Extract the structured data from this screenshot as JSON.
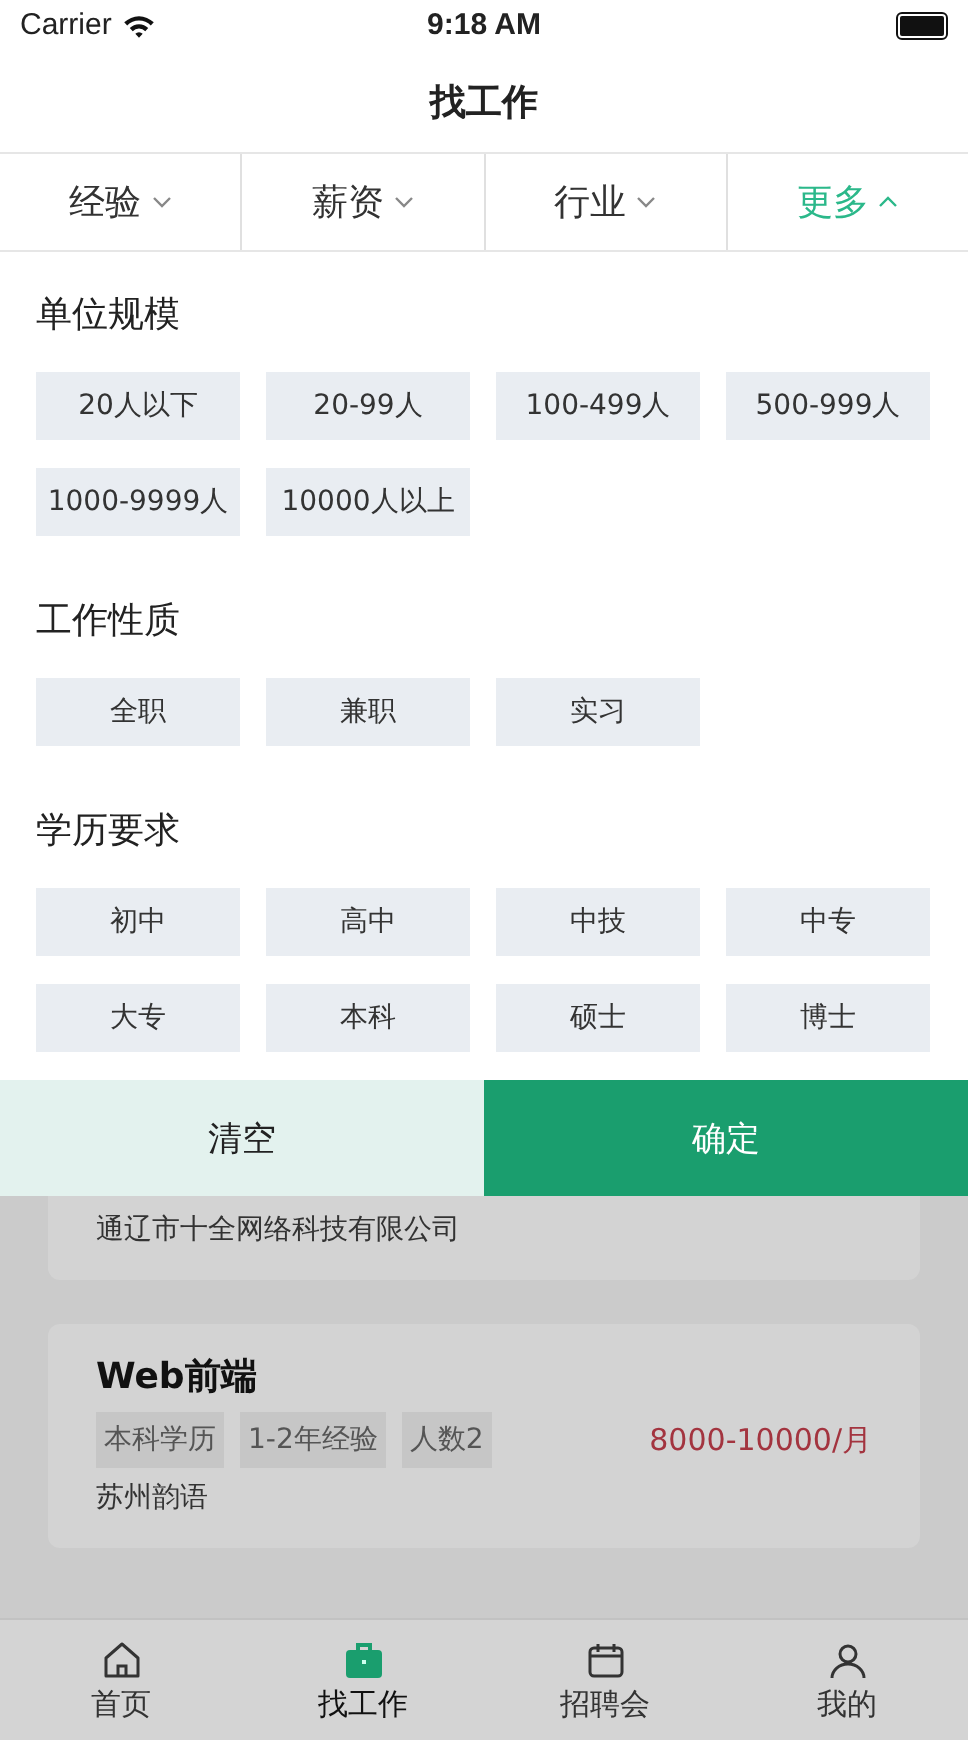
{
  "status_bar": {
    "carrier": "Carrier",
    "time": "9:18 AM"
  },
  "nav": {
    "title": "找工作"
  },
  "filter_tabs": [
    {
      "label": "经验",
      "selected": false
    },
    {
      "label": "薪资",
      "selected": false
    },
    {
      "label": "行业",
      "selected": false
    },
    {
      "label": "更多",
      "selected": true
    }
  ],
  "sections": [
    {
      "title": "单位规模",
      "options": [
        {
          "label": "20人以下",
          "selected": false
        },
        {
          "label": "20-99人",
          "selected": false
        },
        {
          "label": "100-499人",
          "selected": false
        },
        {
          "label": "500-999人",
          "selected": false
        },
        {
          "label": "1000-9999人",
          "selected": false
        },
        {
          "label": "10000人以上",
          "selected": false
        }
      ]
    },
    {
      "title": "工作性质",
      "options": [
        {
          "label": "全职",
          "selected": false
        },
        {
          "label": "兼职",
          "selected": false
        },
        {
          "label": "实习",
          "selected": false
        }
      ]
    },
    {
      "title": "学历要求",
      "options": [
        {
          "label": "初中",
          "selected": false
        },
        {
          "label": "高中",
          "selected": false
        },
        {
          "label": "中技",
          "selected": false
        },
        {
          "label": "中专",
          "selected": false
        },
        {
          "label": "大专",
          "selected": false
        },
        {
          "label": "本科",
          "selected": false
        },
        {
          "label": "硕士",
          "selected": false
        },
        {
          "label": "博士",
          "selected": false
        }
      ]
    }
  ],
  "actions": {
    "clear": "清空",
    "confirm": "确定"
  },
  "jobs": [
    {
      "company": "通辽市十全网络科技有限公司"
    },
    {
      "title": "Web前端",
      "tags": [
        "本科学历",
        "1-2年经验",
        "人数2"
      ],
      "salary": "8000-10000/月",
      "company": "苏州韵语"
    }
  ],
  "tab_bar": [
    {
      "label": "首页",
      "selected": false
    },
    {
      "label": "找工作",
      "selected": true
    },
    {
      "label": "招聘会",
      "selected": false
    },
    {
      "label": "我的",
      "selected": false
    }
  ]
}
